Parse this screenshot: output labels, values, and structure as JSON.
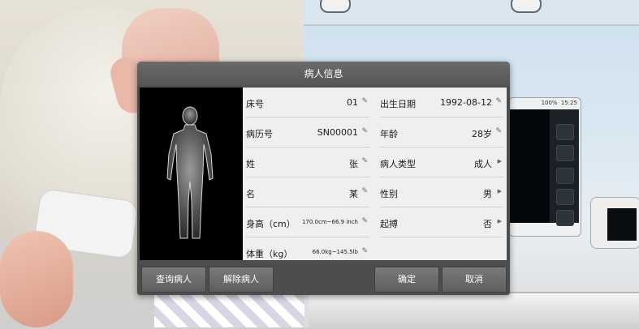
{
  "dialog": {
    "title": "病人信息",
    "fields_left": [
      {
        "label": "床号",
        "value": "01",
        "icon": "pencil-icon"
      },
      {
        "label": "病历号",
        "value": "SN00001",
        "icon": "pencil-icon"
      },
      {
        "label": "姓",
        "value": "张",
        "icon": "pencil-icon"
      },
      {
        "label": "名",
        "value": "某",
        "icon": "pencil-icon"
      },
      {
        "label": "身高（cm）",
        "value": "170.0cm~66.9 inch",
        "icon": "pencil-icon"
      },
      {
        "label": "体重（kg）",
        "value": "66.0kg~145.5lb",
        "icon": "pencil-icon"
      }
    ],
    "fields_right": [
      {
        "label": "出生日期",
        "value": "1992-08-12",
        "icon": "pencil-icon"
      },
      {
        "label": "年龄",
        "value": "28岁",
        "icon": "pencil-icon"
      },
      {
        "label": "病人类型",
        "value": "成人",
        "icon": "arrow-right-icon"
      },
      {
        "label": "性别",
        "value": "男",
        "icon": "arrow-right-icon"
      },
      {
        "label": "起搏",
        "value": "否",
        "icon": "arrow-right-icon"
      }
    ],
    "buttons": {
      "query": "查询病人",
      "release": "解除病人",
      "confirm": "确定",
      "cancel": "取消"
    }
  },
  "monitor": {
    "time": "15:25",
    "battery": "100%"
  },
  "colors": {
    "dialog_bg": "#4d4d4d",
    "field_bg": "#efefef",
    "button_bg": "#6a6a6a"
  }
}
